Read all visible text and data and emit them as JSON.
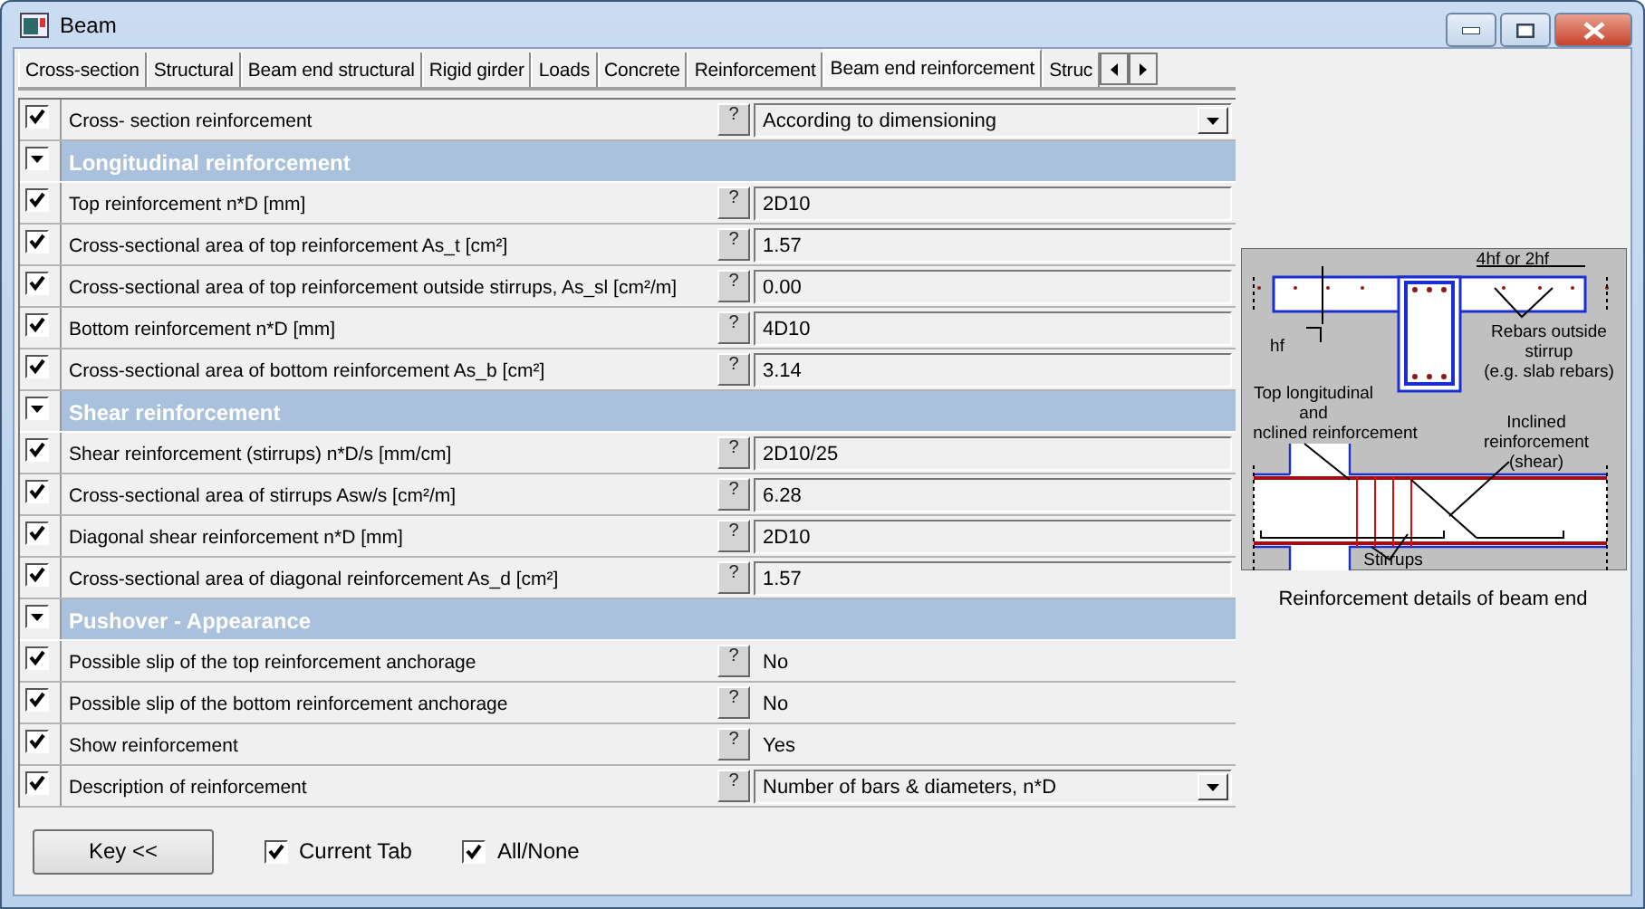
{
  "window": {
    "title": "Beam"
  },
  "tabs": [
    {
      "label": "Cross-section",
      "selected": false
    },
    {
      "label": "Structural",
      "selected": false
    },
    {
      "label": "Beam end structural",
      "selected": false
    },
    {
      "label": "Rigid girder",
      "selected": false
    },
    {
      "label": "Loads",
      "selected": false
    },
    {
      "label": "Concrete",
      "selected": false
    },
    {
      "label": "Reinforcement",
      "selected": false
    },
    {
      "label": "Beam end reinforcement",
      "selected": true
    },
    {
      "label": "Struc",
      "selected": false
    }
  ],
  "rows": [
    {
      "kind": "combo",
      "checked": true,
      "label": "Cross- section reinforcement",
      "help": "?",
      "value": "According to dimensioning"
    },
    {
      "kind": "section",
      "label": "Longitudinal reinforcement"
    },
    {
      "kind": "field",
      "checked": true,
      "label": "Top reinforcement n*D [mm]",
      "help": "?",
      "value": "2D10"
    },
    {
      "kind": "field",
      "checked": true,
      "label": "Cross-sectional area of top reinforcement As_t [cm²]",
      "help": "?",
      "value": "1.57"
    },
    {
      "kind": "field",
      "checked": true,
      "label": "Cross-sectional area of top reinforcement outside stirrups, As_sl [cm²/m]",
      "help": "?",
      "value": "0.00"
    },
    {
      "kind": "field",
      "checked": true,
      "label": "Bottom reinforcement n*D [mm]",
      "help": "?",
      "value": "4D10"
    },
    {
      "kind": "field",
      "checked": true,
      "label": "Cross-sectional area of bottom reinforcement As_b [cm²]",
      "help": "?",
      "value": "3.14"
    },
    {
      "kind": "section",
      "label": "Shear reinforcement"
    },
    {
      "kind": "field",
      "checked": true,
      "label": "Shear reinforcement (stirrups) n*D/s [mm/cm]",
      "help": "?",
      "value": "2D10/25"
    },
    {
      "kind": "field",
      "checked": true,
      "label": "Cross-sectional area of  stirrups Asw/s [cm²/m]",
      "help": "?",
      "value": "6.28"
    },
    {
      "kind": "field",
      "checked": true,
      "label": "Diagonal shear reinforcement n*D [mm]",
      "help": "?",
      "value": "2D10"
    },
    {
      "kind": "field",
      "checked": true,
      "label": "Cross-sectional area of diagonal reinforcement As_d [cm²]",
      "help": "?",
      "value": "1.57"
    },
    {
      "kind": "section",
      "label": "Pushover - Appearance"
    },
    {
      "kind": "plain",
      "checked": true,
      "label": "Possible slip of the top reinforcement anchorage",
      "help": "?",
      "value": "No"
    },
    {
      "kind": "plain",
      "checked": true,
      "label": "Possible slip of the bottom reinforcement anchorage",
      "help": "?",
      "value": "No"
    },
    {
      "kind": "plain",
      "checked": true,
      "label": "Show reinforcement",
      "help": "?",
      "value": "Yes"
    },
    {
      "kind": "combo",
      "checked": true,
      "label": "Description of reinforcement",
      "help": "?",
      "value": "Number of bars & diameters, n*D"
    }
  ],
  "diagram": {
    "labels": [
      "4hf or 2hf",
      "hf",
      "Rebars outside",
      "stirrup",
      "(e.g. slab rebars)",
      "Top longitudinal",
      "and",
      "nclined reinforcement",
      "Inclined",
      "reinforcement",
      "(shear)",
      "Stirrups"
    ],
    "caption": "Reinforcement details of beam end"
  },
  "footer": {
    "key_button": "Key <<",
    "options": [
      {
        "label": "Current Tab",
        "checked": true
      },
      {
        "label": "All/None",
        "checked": true
      }
    ]
  }
}
